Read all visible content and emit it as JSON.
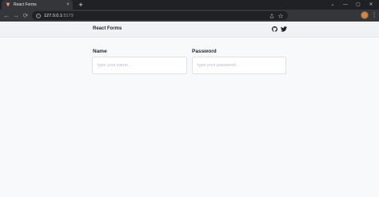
{
  "browser": {
    "tab": {
      "title": "React Forms",
      "close_glyph": "×"
    },
    "new_tab_glyph": "+",
    "window_controls": {
      "dropdown": "⌄",
      "minimize": "—",
      "maximize": "▢",
      "close": "✕"
    },
    "nav": {
      "back": "←",
      "forward": "→",
      "reload": "⟳"
    },
    "address": {
      "host": "127.0.0.1",
      "port": ":5173"
    },
    "menu_glyph": "⋮",
    "extension_colors": [
      "#e8710a",
      "#1e8e3e",
      "#4285f4",
      "#7b61ff",
      "#9aa0a6",
      "#e8eaed"
    ]
  },
  "page": {
    "brand": "React Forms",
    "icons": {
      "github": "github-icon",
      "twitter": "twitter-icon"
    },
    "form": {
      "name_label": "Name",
      "name_placeholder": "type your name...",
      "password_label": "Password",
      "password_placeholder": "type your password..."
    }
  }
}
